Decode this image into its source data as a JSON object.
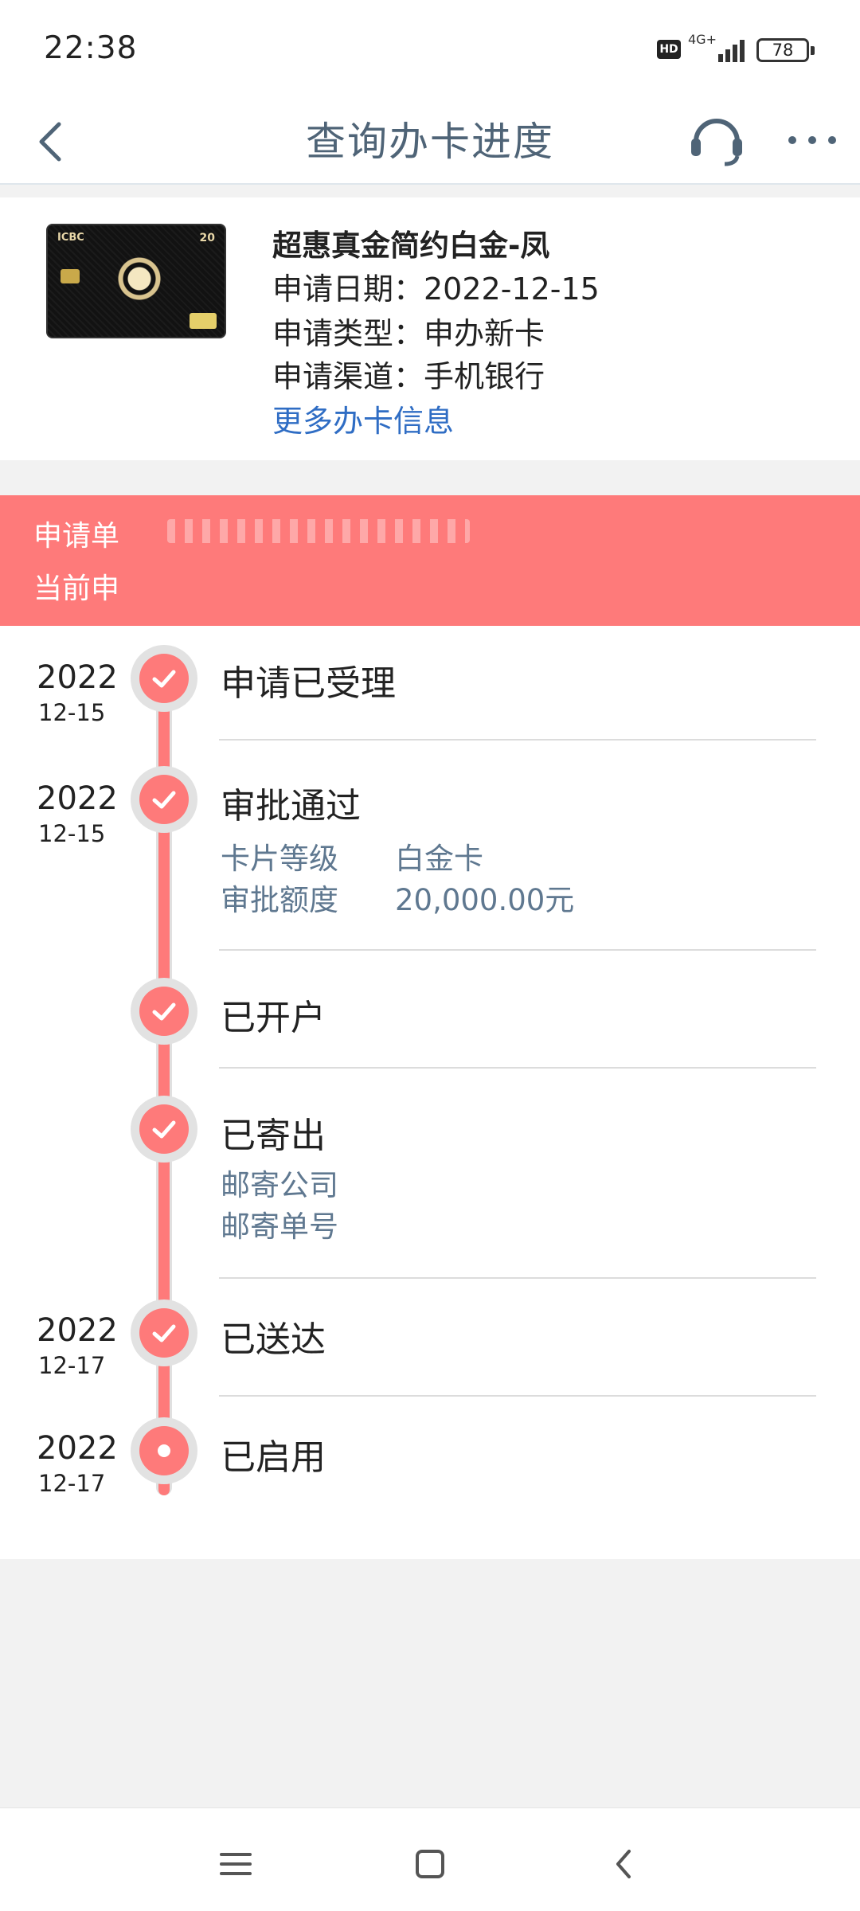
{
  "status_bar": {
    "time": "22:38",
    "hd_badge": "HD",
    "network": "4G+",
    "battery": "78"
  },
  "navbar": {
    "title": "查询办卡进度",
    "icons": [
      "back-chevron-icon",
      "headset-icon",
      "more-dots-icon"
    ]
  },
  "card": {
    "brand": "ICBC",
    "card_number_text": "20",
    "name": "超惠真金简约白金-凤",
    "apply_date": "申请日期：2022-12-15",
    "apply_type": "申请类型：申办新卡",
    "apply_channel": "申请渠道：手机银行",
    "more_link": "更多办卡信息"
  },
  "banner": {
    "application_no_label": "申请单",
    "current_status_label": "当前申"
  },
  "timeline": {
    "steps": [
      {
        "year": "2022",
        "md": "12-15",
        "title": "申请已受理"
      },
      {
        "year": "2022",
        "md": "12-15",
        "title": "审批通过",
        "details": [
          {
            "label": "卡片等级",
            "value": "白金卡"
          },
          {
            "label": "审批额度",
            "value": "20,000.00元"
          }
        ]
      },
      {
        "year": "",
        "md": "",
        "title": "已开户"
      },
      {
        "year": "",
        "md": "",
        "title": "已寄出",
        "details": [
          {
            "label": "邮寄公司",
            "value": ""
          },
          {
            "label": "邮寄单号",
            "value": ""
          }
        ]
      },
      {
        "year": "2022",
        "md": "12-17",
        "title": "已送达"
      },
      {
        "year": "2022",
        "md": "12-17",
        "title": "已启用"
      }
    ]
  },
  "colors": {
    "accent": "#fe7a7a",
    "link": "#2f6dc4",
    "title_gray": "#4f6477",
    "detail_gray": "#5f7890"
  }
}
